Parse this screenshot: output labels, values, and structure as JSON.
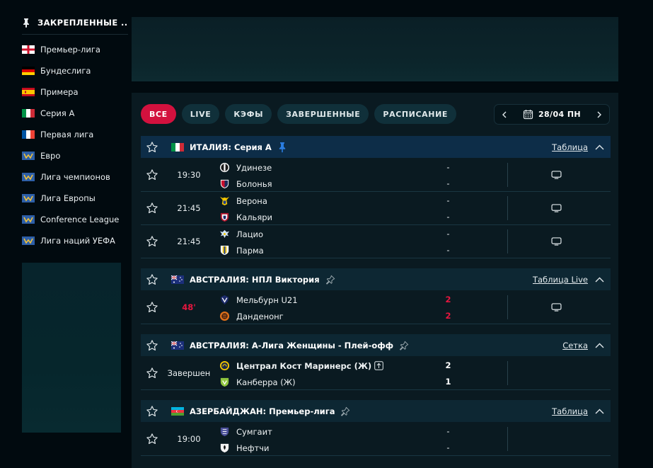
{
  "sidebar": {
    "title": "ЗАКРЕПЛЕННЫЕ ...",
    "items": [
      {
        "label": "Премьер-лига",
        "flag": "england-flag"
      },
      {
        "label": "Бундеслига",
        "flag": "germany-flag"
      },
      {
        "label": "Примера",
        "flag": "spain-flag"
      },
      {
        "label": "Серия А",
        "flag": "italy-flag"
      },
      {
        "label": "Первая лига",
        "flag": "france-flag"
      },
      {
        "label": "Евро",
        "flag": "europe-flag"
      },
      {
        "label": "Лига чемпионов",
        "flag": "europe-flag"
      },
      {
        "label": "Лига Европы",
        "flag": "europe-flag"
      },
      {
        "label": "Conference League",
        "flag": "europe-flag"
      },
      {
        "label": "Лига наций УЕФА",
        "flag": "europe-flag"
      }
    ]
  },
  "filters": {
    "all": "ВСЕ",
    "live": "LIVE",
    "odds": "КЭФЫ",
    "finished": "ЗАВЕРШЕННЫЕ",
    "schedule": "РАСПИСАНИЕ"
  },
  "date": "28/04 ПН",
  "leagues": [
    {
      "name": "ИТАЛИЯ: Серия А",
      "link": "Таблица",
      "matches": [
        {
          "time": "19:30",
          "home": "Удинезе",
          "away": "Болонья",
          "home_score": "-",
          "away_score": "-"
        },
        {
          "time": "21:45",
          "home": "Верона",
          "away": "Кальяри",
          "home_score": "-",
          "away_score": "-"
        },
        {
          "time": "21:45",
          "home": "Лацио",
          "away": "Парма",
          "home_score": "-",
          "away_score": "-"
        }
      ]
    },
    {
      "name": "АВСТРАЛИЯ: НПЛ Виктория",
      "link": "Таблица Live",
      "matches": [
        {
          "time": "48'",
          "home": "Мельбурн U21",
          "away": "Данденонг",
          "home_score": "2",
          "away_score": "2"
        }
      ]
    },
    {
      "name": "АВСТРАЛИЯ: А-Лига Женщины - Плей-офф",
      "link": "Сетка",
      "matches": [
        {
          "time": "Завершен",
          "home": "Централ Кост Маринерс (Ж)",
          "away": "Канберра (Ж)",
          "home_score": "2",
          "away_score": "1"
        }
      ]
    },
    {
      "name": "АЗЕРБАЙДЖАН: Премьер-лига",
      "link": "Таблица",
      "matches": [
        {
          "time": "19:00",
          "home": "Сумгаит",
          "away": "Нефтчи",
          "home_score": "-",
          "away_score": "-"
        }
      ]
    }
  ],
  "colors": {
    "accent": "#d3113e",
    "live": "#e6163f",
    "pinned_blue": "#2a7de1",
    "background": "#010a0f"
  }
}
